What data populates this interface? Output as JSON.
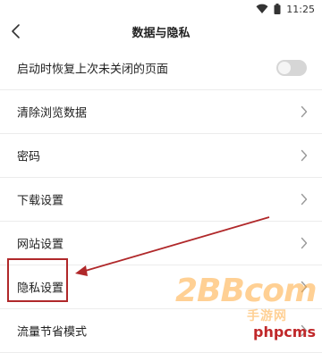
{
  "status": {
    "time": "11:25"
  },
  "header": {
    "title": "数据与隐私"
  },
  "items": [
    {
      "label": "启动时恢复上次未关闭的页面",
      "type": "toggle",
      "on": false
    },
    {
      "label": "清除浏览数据",
      "type": "link"
    },
    {
      "label": "密码",
      "type": "link"
    },
    {
      "label": "下载设置",
      "type": "link"
    },
    {
      "label": "网站设置",
      "type": "link"
    },
    {
      "label": "隐私设置",
      "type": "link"
    },
    {
      "label": "流量节省模式",
      "type": "link"
    }
  ],
  "watermark": {
    "main": "2BBcom",
    "sub": "手游网",
    "site": "phpcms"
  },
  "colors": {
    "annotation": "#b0282a"
  }
}
